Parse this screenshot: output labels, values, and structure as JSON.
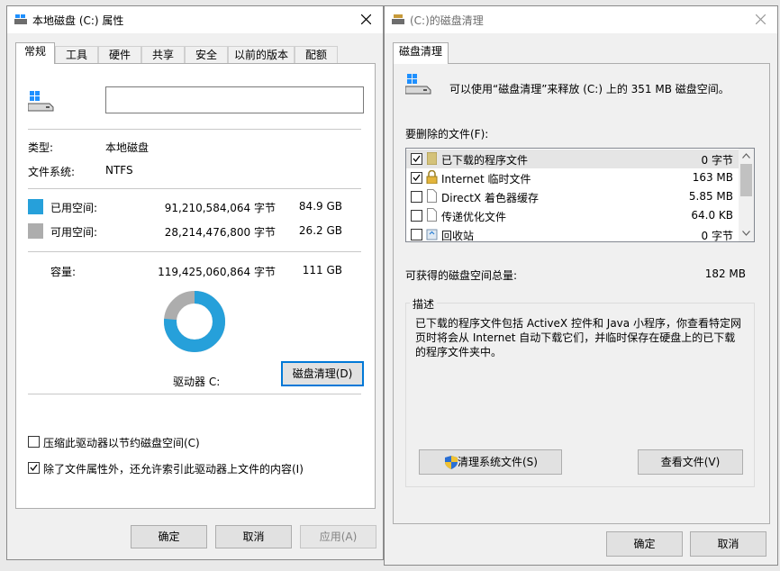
{
  "properties": {
    "title": "本地磁盘 (C:) 属性",
    "tabs": [
      "常规",
      "工具",
      "硬件",
      "共享",
      "安全",
      "以前的版本",
      "配额"
    ],
    "volume_label_value": "",
    "type_label": "类型:",
    "type_value": "本地磁盘",
    "fs_label": "文件系统:",
    "fs_value": "NTFS",
    "used_label": "已用空间:",
    "used_bytes": "91,210,584,064 字节",
    "used_gb": "84.9 GB",
    "free_label": "可用空间:",
    "free_bytes": "28,214,476,800 字节",
    "free_gb": "26.2 GB",
    "capacity_label": "容量:",
    "capacity_bytes": "119,425,060,864 字节",
    "capacity_gb": "111 GB",
    "drive_label": "驱动器 C:",
    "cleanup_button": "磁盘清理(D)",
    "compress_label": "压缩此驱动器以节约磁盘空间(C)",
    "compress_checked": false,
    "index_label": "除了文件属性外，还允许索引此驱动器上文件的内容(I)",
    "index_checked": true,
    "ok": "确定",
    "cancel": "取消",
    "apply": "应用(A)",
    "colors": {
      "used": "#26a0da",
      "free": "#adadad"
    },
    "used_fraction": 0.7638
  },
  "cleanup": {
    "title": "(C:)的磁盘清理",
    "tab": "磁盘清理",
    "intro": "可以使用“磁盘清理”来释放  (C:) 上的 351 MB 磁盘空间。",
    "files_label": "要删除的文件(F):",
    "files": [
      {
        "name": "已下载的程序文件",
        "size": "0 字节",
        "checked": true,
        "icon": "folder-icon"
      },
      {
        "name": "Internet 临时文件",
        "size": "163 MB",
        "checked": true,
        "icon": "lock-icon"
      },
      {
        "name": "DirectX 着色器缓存",
        "size": "5.85 MB",
        "checked": false,
        "icon": "file-icon"
      },
      {
        "name": "传递优化文件",
        "size": "64.0 KB",
        "checked": false,
        "icon": "file-icon"
      },
      {
        "name": "回收站",
        "size": "0 字节",
        "checked": false,
        "icon": "recycle-bin-icon"
      }
    ],
    "total_label": "可获得的磁盘空间总量:",
    "total_value": "182 MB",
    "desc_title": "描述",
    "desc_text": "已下载的程序文件包括 ActiveX 控件和 Java 小程序，你查看特定网页时将会从 Internet 自动下载它们，并临时保存在硬盘上的已下载的程序文件夹中。",
    "sys_button": "清理系统文件(S)",
    "view_button": "查看文件(V)",
    "ok": "确定",
    "cancel": "取消"
  }
}
